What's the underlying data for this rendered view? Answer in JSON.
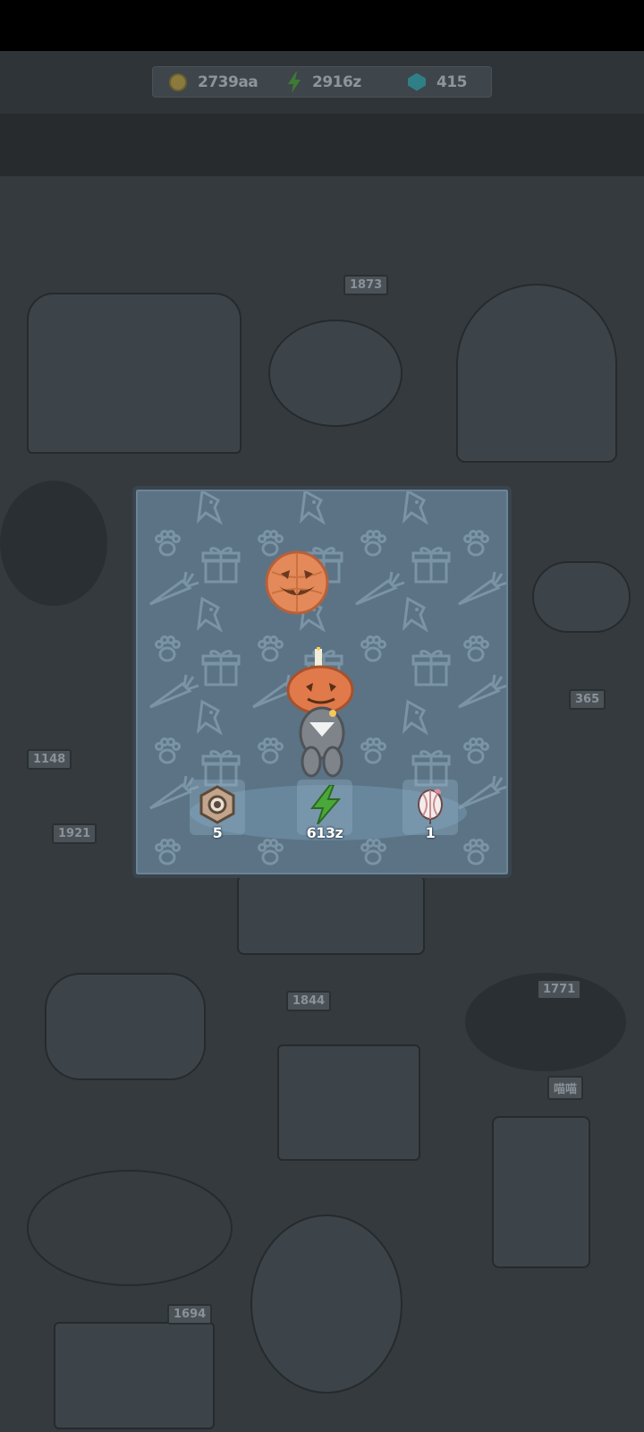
{
  "resources": {
    "coins": "2739aa",
    "energy": "2916z",
    "gems": "415"
  },
  "world_signs": [
    "1873",
    "1148",
    "1921",
    "365",
    "1844",
    "1771",
    "1694",
    "喵喵"
  ],
  "reward_popup": {
    "rewards": [
      {
        "icon": "hex-nut-icon",
        "amount": "5"
      },
      {
        "icon": "lightning-bolt-icon",
        "amount": "613z"
      },
      {
        "icon": "paper-lantern-icon",
        "amount": "1"
      }
    ]
  },
  "colors": {
    "panel_bg": "#5b7385",
    "pattern": "#7a93a5",
    "pumpkin": "#e48a5a",
    "energy_green": "#4aa83a"
  }
}
